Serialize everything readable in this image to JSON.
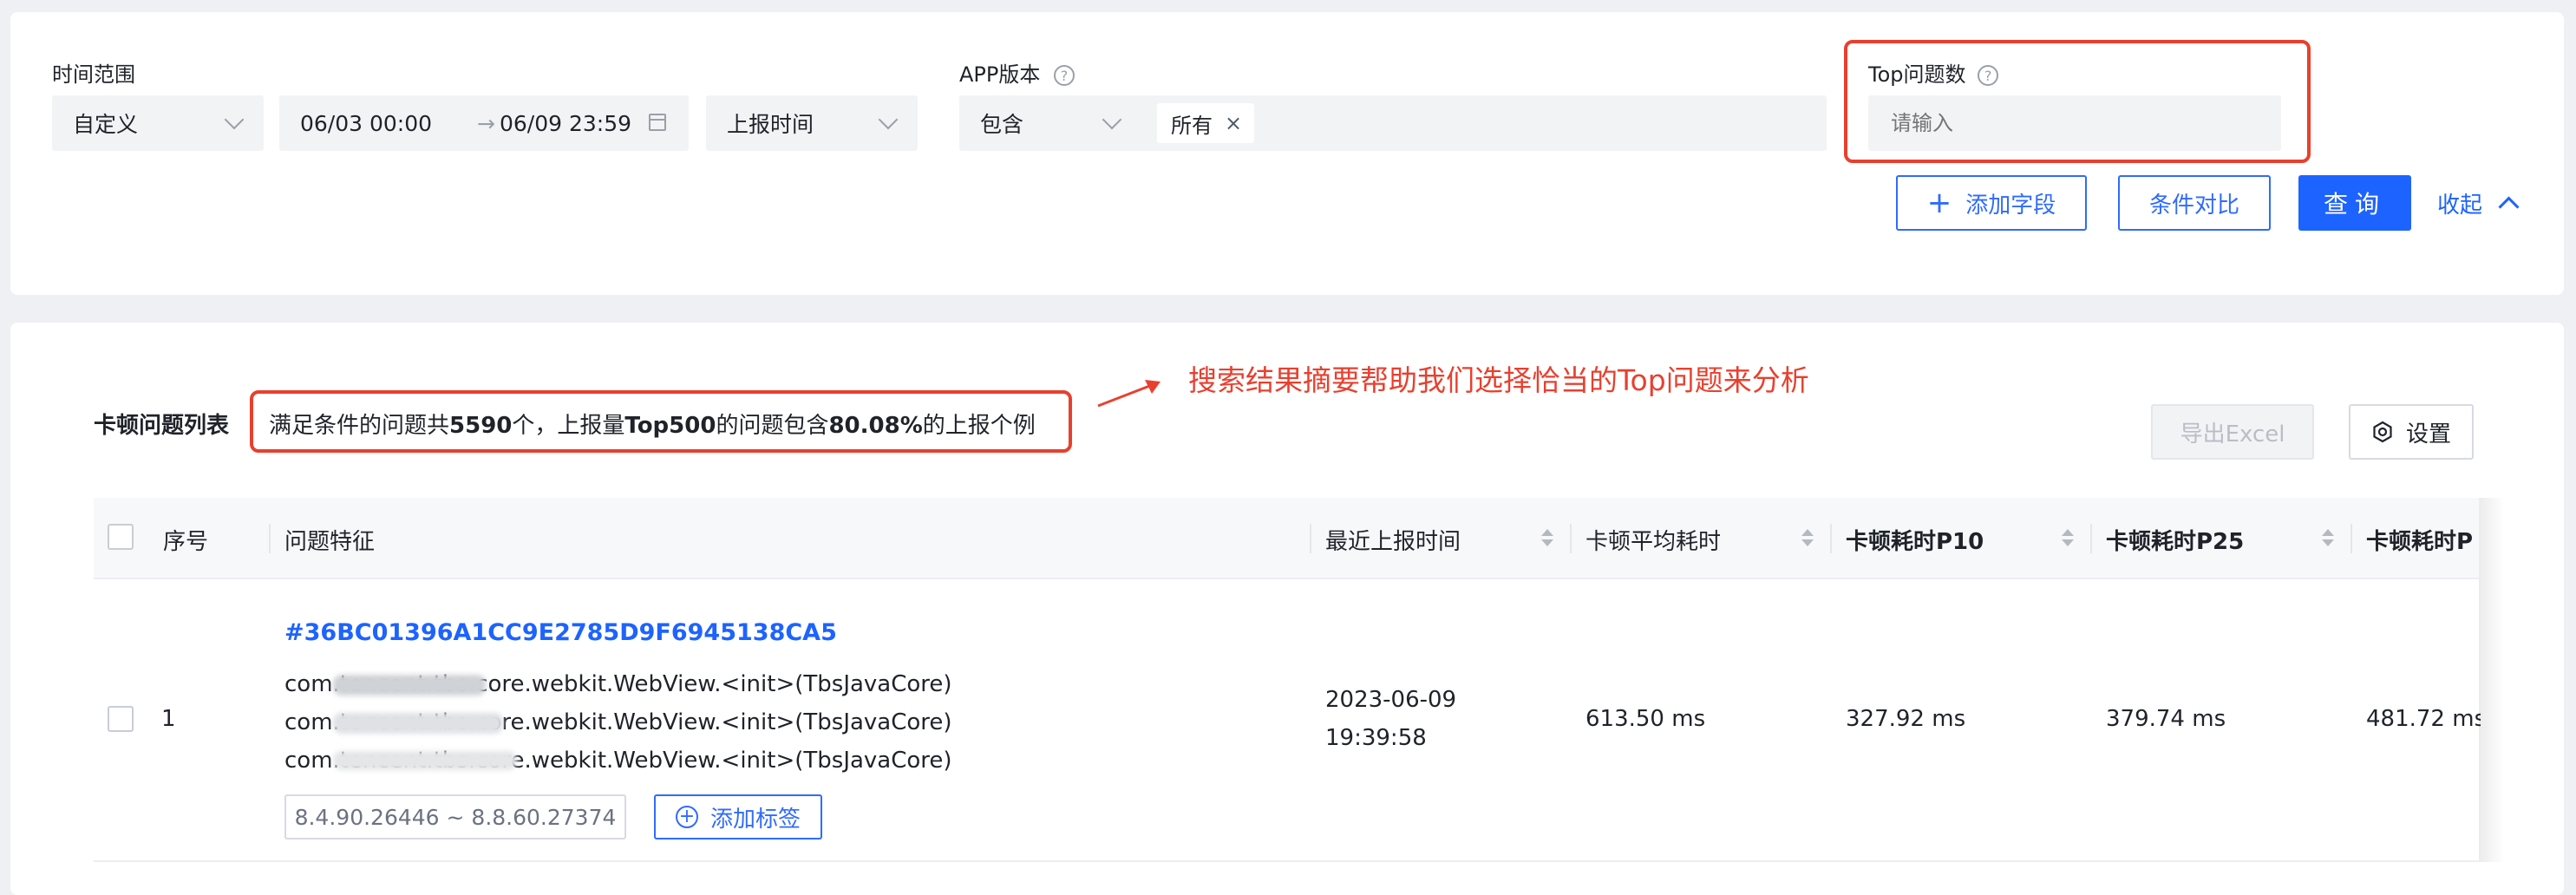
{
  "filters": {
    "time_range_label": "时间范围",
    "time_mode_value": "自定义",
    "date_start": "06/03 00:00",
    "date_separator": "→",
    "date_end": "06/09 23:59",
    "time_field_value": "上报时间",
    "app_version_label": "APP版本",
    "app_version_op": "包含",
    "app_version_tag": "所有",
    "top_label": "Top问题数",
    "top_placeholder": "请输入"
  },
  "actions": {
    "add_field": "添加字段",
    "compare": "条件对比",
    "query": "查询",
    "collapse": "收起"
  },
  "annotation": {
    "note": "搜索结果摘要帮助我们选择恰当的Top问题来分析"
  },
  "list": {
    "title": "卡顿问题列表",
    "summary_prefix": "满足条件的问题共",
    "summary_count": "5590",
    "summary_mid": "个，上报量",
    "summary_top": "Top500",
    "summary_mid2": "的问题包含",
    "summary_pct": "80.08%",
    "summary_suffix": "的上报个例",
    "export": "导出Excel",
    "settings": "设置"
  },
  "table": {
    "headers": [
      "序号",
      "问题特征",
      "最近上报时间",
      "卡顿平均耗时",
      "卡顿耗时P10",
      "卡顿耗时P25",
      "卡顿耗时P"
    ],
    "rows": [
      {
        "index": "1",
        "issue_id": "#36BC01396A1CC9E2785D9F6945138CA5",
        "stack": [
          "com.tencent.tbs.core.webkit.WebView.<init>(TbsJavaCore)",
          "com.tencent.tbs.core.webkit.WebView.<init>(TbsJavaCore)",
          "com.tencent.tbs.core.webkit.WebView.<init>(TbsJavaCore)"
        ],
        "version_range": "8.4.90.26446 ~ 8.8.60.27374",
        "add_tag": "添加标签",
        "last_report_date": "2023-06-09",
        "last_report_time": "19:39:58",
        "avg": "613.50 ms",
        "p10": "327.92 ms",
        "p25": "379.74 ms",
        "p_next": "481.72 ms"
      }
    ]
  },
  "colors": {
    "accent": "#1d63ff",
    "highlight_red": "#e8402f"
  }
}
